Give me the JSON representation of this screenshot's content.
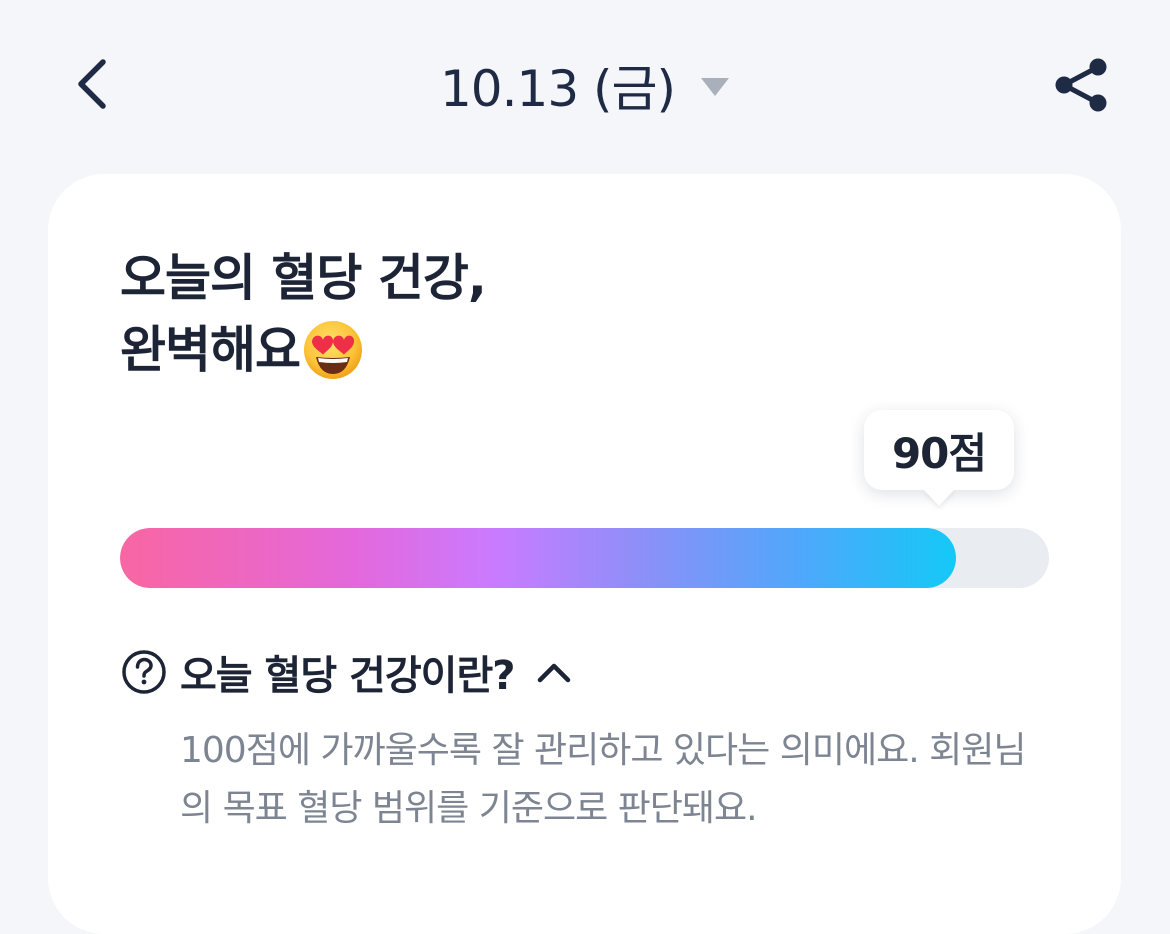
{
  "header": {
    "back_icon": "chevron-left-icon",
    "date_label": "10.13 (금)",
    "dropdown_icon": "caret-down-icon",
    "share_icon": "share-icon"
  },
  "card": {
    "headline_line1": "오늘의 혈당 건강,",
    "headline_line2": "완벽해요",
    "headline_emoji": "heart-eyes-emoji",
    "score_label": "90점",
    "score_value": 90,
    "score_max": 100,
    "info": {
      "help_icon": "question-circle-icon",
      "title": "오늘 혈당 건강이란?",
      "toggle_icon": "chevron-up-icon",
      "description": "100점에 가까울수록 잘 관리하고 있다는 의미에요. 회원님의 목표 혈당 범위를 기준으로 판단돼요."
    }
  },
  "colors": {
    "background": "#f4f6fa",
    "card": "#ffffff",
    "text_primary": "#1d2436",
    "text_secondary": "#7e8592",
    "gradient_start": "#f866a2",
    "gradient_mid": "#c97bff",
    "gradient_end": "#14c9f7",
    "track": "#e9edf1"
  }
}
